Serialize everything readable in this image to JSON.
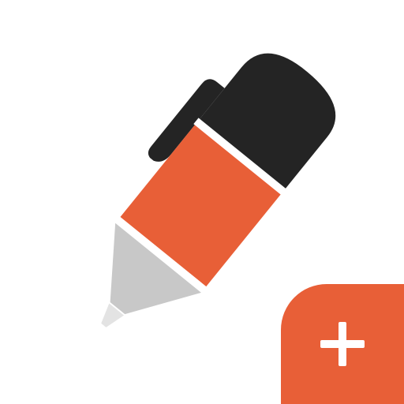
{
  "icon": {
    "name": "pen-icon",
    "colors": {
      "background": "#ffffff",
      "cap": "#242424",
      "barrel": "#e85f37",
      "cone": "#c8c8c8",
      "tip": "#e3e3e3",
      "separator": "#ffffff"
    }
  },
  "add_button": {
    "icon": "plus-icon",
    "colors": {
      "background": "#e85f37",
      "symbol": "#ffffff"
    }
  }
}
